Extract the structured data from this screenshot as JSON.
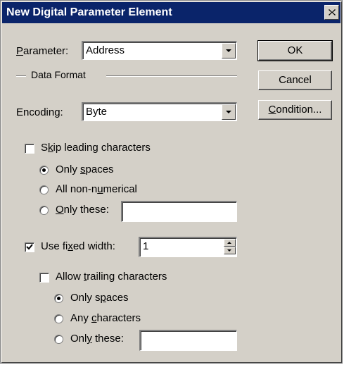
{
  "window": {
    "title": "New Digital Parameter Element"
  },
  "parameter": {
    "prefix": "",
    "accel": "P",
    "suffix": "arameter:",
    "value": "Address"
  },
  "data_format": {
    "label": "Data Format"
  },
  "encoding": {
    "label": "Encoding:",
    "value": "Byte"
  },
  "buttons": {
    "ok": "OK",
    "cancel": "Cancel",
    "condition_accel": "C",
    "condition_suffix": "ondition..."
  },
  "skip_leading": {
    "checked": false,
    "prefix": "S",
    "accel": "k",
    "suffix": "ip leading characters",
    "options": [
      {
        "prefix": "Only ",
        "accel": "s",
        "suffix": "paces",
        "selected": true
      },
      {
        "prefix": "All non-n",
        "accel": "u",
        "suffix": "merical",
        "selected": false
      },
      {
        "prefix": "",
        "accel": "O",
        "suffix": "nly these:",
        "selected": false
      }
    ],
    "only_these_value": ""
  },
  "fixed_width": {
    "checked": true,
    "prefix": "Use fi",
    "accel": "x",
    "suffix": "ed width:",
    "value": "1"
  },
  "allow_trailing": {
    "checked": false,
    "prefix": "Allow ",
    "accel": "t",
    "suffix": "railing characters",
    "options": [
      {
        "prefix": "Only s",
        "accel": "p",
        "suffix": "aces",
        "selected": true
      },
      {
        "prefix": "Any ",
        "accel": "c",
        "suffix": "haracters",
        "selected": false
      },
      {
        "prefix": "Onl",
        "accel": "y",
        "suffix": " these:",
        "selected": false
      }
    ],
    "only_these_value": ""
  },
  "colors": {
    "titlebar": "#0a246a",
    "face": "#d4d0c8"
  },
  "icons": {
    "close": "close-icon",
    "dropdown": "chevron-down-icon",
    "check": "check-icon"
  }
}
